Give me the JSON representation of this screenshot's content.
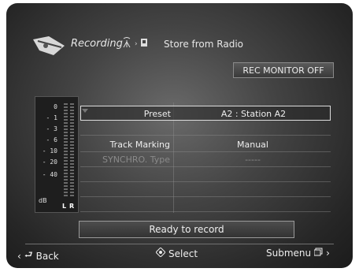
{
  "header": {
    "title": "Recording",
    "store_label": "Store from Radio",
    "logo_icon": "record-cassette-icon",
    "radio_icon": "antenna-icon",
    "disc_icon": "disc-icon"
  },
  "monitor": {
    "label": "REC MONITOR OFF"
  },
  "meter": {
    "scale": [
      "0",
      "- 1",
      "- 3",
      "- 6",
      "- 10",
      "- 20",
      "- 40"
    ],
    "unit": "dB",
    "channels": [
      "L",
      "R"
    ]
  },
  "settings": [
    {
      "label": "Preset",
      "value": "A2 : Station A2",
      "selected": true,
      "dimmed": false
    },
    {
      "label": "",
      "value": "",
      "selected": false,
      "dimmed": false
    },
    {
      "label": "Track Marking",
      "value": "Manual",
      "selected": false,
      "dimmed": false
    },
    {
      "label": "SYNCHRO. Type",
      "value": "-----",
      "selected": false,
      "dimmed": true
    }
  ],
  "status": {
    "text": "Ready to record"
  },
  "footer": {
    "back": "Back",
    "select": "Select",
    "submenu": "Submenu"
  },
  "colors": {
    "background": "#3a3a3a",
    "text": "#eeeeee",
    "dimmed": "#8a8a8a"
  }
}
